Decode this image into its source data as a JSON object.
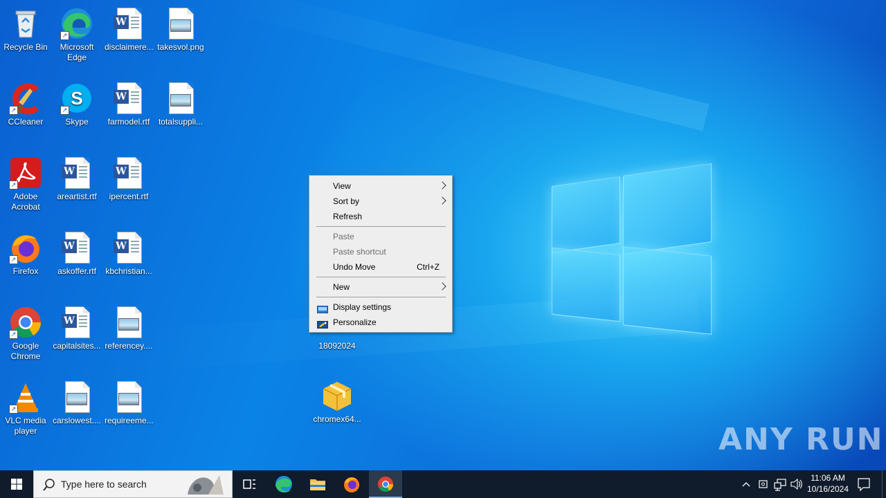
{
  "desktop_icons": [
    {
      "label": "Recycle Bin"
    },
    {
      "label": "Microsoft Edge"
    },
    {
      "label": "disclaimere..."
    },
    {
      "label": "takesvol.png"
    },
    {
      "label": "CCleaner"
    },
    {
      "label": "Skype"
    },
    {
      "label": "farmodel.rtf"
    },
    {
      "label": "totalsuppli..."
    },
    {
      "label": "Adobe Acrobat"
    },
    {
      "label": "areartist.rtf"
    },
    {
      "label": "ipercent.rtf"
    },
    {
      "label": "Firefox"
    },
    {
      "label": "askoffer.rtf"
    },
    {
      "label": "kbchristian..."
    },
    {
      "label": "Google Chrome"
    },
    {
      "label": "capitalsites..."
    },
    {
      "label": "referencey...."
    },
    {
      "label": "VLC media player"
    },
    {
      "label": "carslowest...."
    },
    {
      "label": "requireeme..."
    },
    {
      "label": "18092024"
    },
    {
      "label": "chromex64..."
    }
  ],
  "context_menu": {
    "items": [
      {
        "label": "View",
        "submenu": true
      },
      {
        "label": "Sort by",
        "submenu": true
      },
      {
        "label": "Refresh"
      },
      {
        "label": "Paste",
        "disabled": true
      },
      {
        "label": "Paste shortcut",
        "disabled": true
      },
      {
        "label": "Undo Move",
        "shortcut": "Ctrl+Z"
      },
      {
        "label": "New",
        "submenu": true
      },
      {
        "label": "Display settings",
        "icon": "display-icon"
      },
      {
        "label": "Personalize",
        "icon": "personalize-icon"
      }
    ]
  },
  "taskbar": {
    "search_placeholder": "Type here to search",
    "clock_time": "11:06 AM",
    "clock_date": "10/16/2024",
    "pinned": [
      "task-view-icon",
      "edge-icon",
      "file-explorer-icon",
      "firefox-icon",
      "chrome-icon"
    ]
  },
  "watermark": "ANY RUN"
}
